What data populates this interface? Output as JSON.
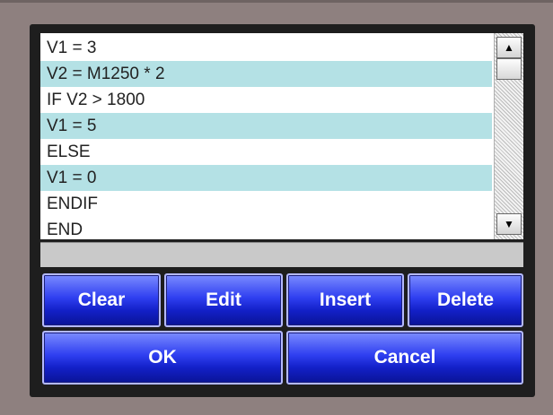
{
  "program": {
    "lines": [
      "V1 = 3",
      "V2 = M1250 * 2",
      "IF V2 > 1800",
      "V1 = 5",
      "ELSE",
      "V1 = 0",
      "ENDIF",
      "END"
    ],
    "edit_field_value": ""
  },
  "scrollbar": {
    "up_glyph": "▲",
    "down_glyph": "▼"
  },
  "buttons": {
    "clear": "Clear",
    "edit": "Edit",
    "insert": "Insert",
    "delete": "Delete",
    "ok": "OK",
    "cancel": "Cancel"
  },
  "colors": {
    "bezel": "#8e807f",
    "row_highlight": "#b4e1e5",
    "button_blue": "#2f3ff0"
  }
}
